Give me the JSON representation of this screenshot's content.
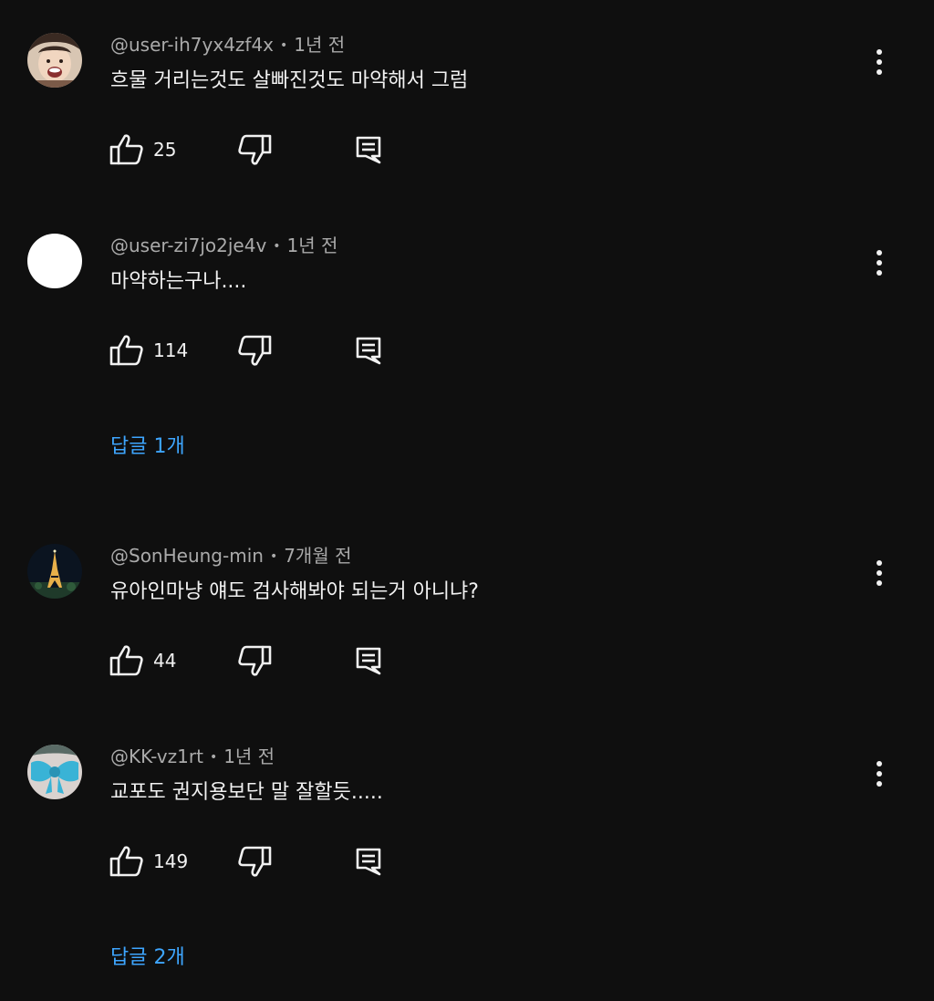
{
  "comments": [
    {
      "author": "@user-ih7yx4zf4x",
      "time": "1년 전",
      "text": "흐물 거리는것도 살빠진것도 마약해서 그럼",
      "likes": "25",
      "avatar": "face-photo"
    },
    {
      "author": "@user-zi7jo2je4v",
      "time": "1년 전",
      "text": "마약하는구나....",
      "likes": "114",
      "avatar": "blank-white",
      "replies": "답글 1개"
    },
    {
      "author": "@SonHeung-min",
      "time": "7개월 전",
      "text": "유아인마냥 얘도 검사해봐야 되는거 아니냐?",
      "likes": "44",
      "avatar": "eiffel-tower-night"
    },
    {
      "author": "@KK-vz1rt",
      "time": "1년 전",
      "text": "교포도 권지용보단 말 잘할듯.....",
      "likes": "149",
      "avatar": "blue-bow",
      "replies": "답글 2개"
    }
  ],
  "separator": "•",
  "icons": {
    "like": "thumbs-up-icon",
    "dislike": "thumbs-down-icon",
    "reply": "reply-comment-icon",
    "menu": "more-vertical-icon"
  },
  "colors": {
    "background": "#0f0f0f",
    "text": "#f1f1f1",
    "meta": "#aaaaaa",
    "link": "#3ea6ff"
  }
}
